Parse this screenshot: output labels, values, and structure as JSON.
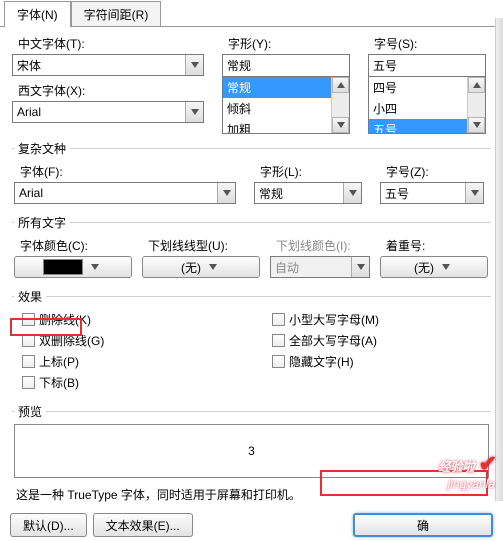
{
  "tabs": {
    "font": "字体(N)",
    "spacing": "字符间距(R)"
  },
  "top": {
    "cn_font_label": "中文字体(T):",
    "cn_font_value": "宋体",
    "west_font_label": "西文字体(X):",
    "west_font_value": "Arial",
    "style_label": "字形(Y):",
    "style_value": "常规",
    "style_list": [
      "常规",
      "倾斜",
      "加粗"
    ],
    "size_label": "字号(S):",
    "size_value": "五号",
    "size_list": [
      "四号",
      "小四",
      "五号"
    ]
  },
  "complex": {
    "legend": "复杂文种",
    "font_label": "字体(F):",
    "font_value": "Arial",
    "style_label": "字形(L):",
    "style_value": "常规",
    "size_label": "字号(Z):",
    "size_value": "五号"
  },
  "alltext": {
    "legend": "所有文字",
    "color_label": "字体颜色(C):",
    "underline_style_label": "下划线线型(U):",
    "underline_style_value": "(无)",
    "underline_color_label": "下划线颜色(I):",
    "underline_color_value": "自动",
    "emphasis_label": "着重号:",
    "emphasis_value": "(无)"
  },
  "effects": {
    "legend": "效果",
    "left": {
      "strike": "删除线(K)",
      "dstrike": "双删除线(G)",
      "super": "上标(P)",
      "sub": "下标(B)"
    },
    "right": {
      "smallcaps": "小型大写字母(M)",
      "allcaps": "全部大写字母(A)",
      "hidden": "隐藏文字(H)"
    }
  },
  "preview": {
    "legend": "预览",
    "sample": "3"
  },
  "note": "这是一种 TrueType 字体，同时适用于屏幕和打印机。",
  "buttons": {
    "default": "默认(D)...",
    "texteffect": "文本效果(E)...",
    "ok": "确",
    "cancel": ""
  },
  "watermark": {
    "line1": "经验啦",
    "line2": "jingyanla"
  }
}
